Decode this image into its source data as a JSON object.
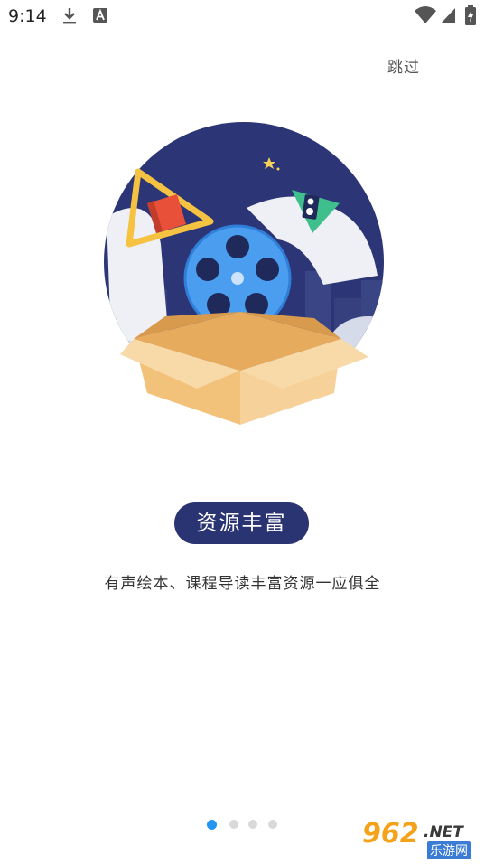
{
  "status_bar": {
    "time": "9:14",
    "icons": [
      "download-icon",
      "text-a-icon",
      "wifi-icon",
      "signal-icon",
      "battery-icon"
    ]
  },
  "skip_label": "跳过",
  "hero": {
    "icons": [
      "book-icon",
      "film-reel-icon",
      "speaker-icon",
      "cardboard-box-icon",
      "star-icon"
    ],
    "colors": {
      "circle": "#2c3575",
      "box": "#f3c27a",
      "reel": "#4b9df0",
      "triangle_yellow": "#f5c341",
      "triangle_green": "#3fbf8c"
    }
  },
  "title": "资源丰富",
  "subtitle": "有声绘本、课程导读丰富资源一应俱全",
  "pager": {
    "count": 4,
    "active": 0
  },
  "watermark": {
    "number": "962",
    "suffix": ".NET",
    "chinese": "乐游网"
  },
  "colors": {
    "accent": "#2196f3",
    "pill": "#2a3472"
  }
}
